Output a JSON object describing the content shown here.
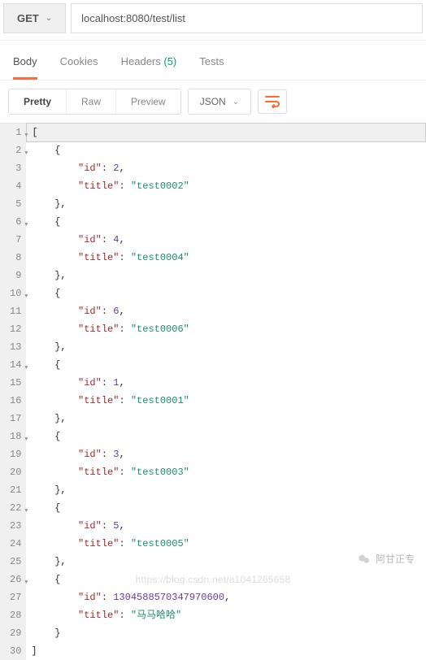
{
  "request": {
    "method": "GET",
    "url": "localhost:8080/test/list"
  },
  "tabs": {
    "body": "Body",
    "cookies": "Cookies",
    "headers": "Headers",
    "headers_count": "(5)",
    "tests": "Tests"
  },
  "views": {
    "pretty": "Pretty",
    "raw": "Raw",
    "preview": "Preview"
  },
  "format": {
    "label": "JSON"
  },
  "chart_data": {
    "type": "table",
    "columns": [
      "id",
      "title"
    ],
    "rows": [
      {
        "id": 2,
        "title": "test0002"
      },
      {
        "id": 4,
        "title": "test0004"
      },
      {
        "id": 6,
        "title": "test0006"
      },
      {
        "id": 1,
        "title": "test0001"
      },
      {
        "id": 3,
        "title": "test0003"
      },
      {
        "id": 5,
        "title": "test0005"
      },
      {
        "id": 1304588570347970561,
        "title": "马马哈哈"
      }
    ]
  },
  "watermark": {
    "author": "阿甘正专",
    "url": "https://blog.csdn.net/a1041265658"
  }
}
